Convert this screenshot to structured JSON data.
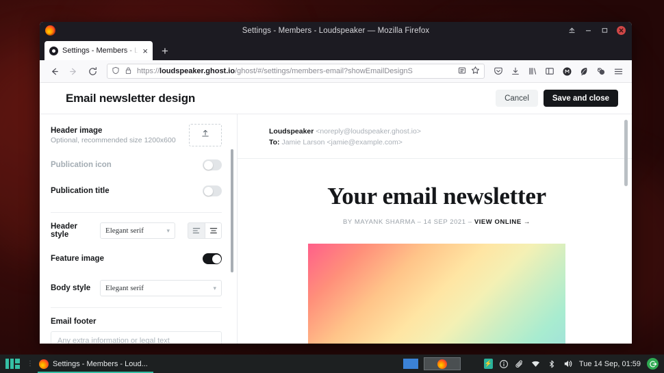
{
  "window": {
    "title": "Settings - Members - Loudspeaker — Mozilla Firefox",
    "controls": {
      "shade_label": "Shade",
      "minimize_label": "Minimize",
      "maximize_label": "Maximize",
      "close_label": "Close"
    }
  },
  "browser": {
    "tab": {
      "title": "Settings - Members - Loud",
      "close_glyph": "×"
    },
    "new_tab_glyph": "+",
    "nav": {
      "back_glyph": "←",
      "forward_glyph": "→",
      "reload_glyph": "↻"
    },
    "url": {
      "scheme": "https://",
      "domain": "loudspeaker.ghost.io",
      "path": "/ghost/#/settings/members-email?showEmailDesignS",
      "full": "https://loudspeaker.ghost.io/ghost/#/settings/members-email?showEmailDesignS"
    },
    "toolbar_icons": [
      "pocket-icon",
      "download-icon",
      "library-icon",
      "sidebar-icon",
      "extension-dark-icon",
      "extension-green-icon",
      "extension-gray-icon",
      "app-menu-icon"
    ]
  },
  "modal": {
    "title": "Email newsletter design",
    "cancel_label": "Cancel",
    "save_label": "Save and close"
  },
  "settings": {
    "header_image": {
      "label": "Header image",
      "sublabel": "Optional, recommended size 1200x600",
      "upload_icon": "upload-icon"
    },
    "publication_icon": {
      "label": "Publication icon",
      "state": "off"
    },
    "publication_title": {
      "label": "Publication title",
      "state": "off"
    },
    "header_style": {
      "label": "Header style",
      "value": "Elegant serif",
      "align_left": "align-left",
      "align_center": "align-center",
      "selected_align": "align-center"
    },
    "feature_image": {
      "label": "Feature image",
      "state": "on"
    },
    "body_style": {
      "label": "Body style",
      "value": "Elegant serif"
    },
    "email_footer": {
      "label": "Email footer",
      "placeholder": "Any extra information or legal text",
      "value": ""
    }
  },
  "preview": {
    "from_name": "Loudspeaker",
    "from_email": "<noreply@loudspeaker.ghost.io>",
    "to_label": "To:",
    "to_value": "Jamie Larson <jamie@example.com>",
    "newsletter_title": "Your email newsletter",
    "byline_author": "BY MAYANK SHARMA",
    "byline_date": "14 SEP 2021",
    "byline_link": "VIEW ONLINE →",
    "byline_sep": "–",
    "hero_colors": [
      "#ff5f8a",
      "#ffc489",
      "#ffe5a3",
      "#a8ecd0",
      "#9fdfdc"
    ]
  },
  "taskbar": {
    "menu_icon": "manjaro-logo-icon",
    "task_title": "Settings - Members - Loud...",
    "clock": "Tue 14 Sep, 01:59",
    "tray_icons": [
      "battery-icon",
      "info-icon",
      "clipboard-icon",
      "wifi-icon",
      "bluetooth-icon",
      "volume-icon"
    ],
    "logout_icon": "logout-icon"
  },
  "colors": {
    "accent_teal": "#35bfa4",
    "ghost_dark": "#15171a",
    "taskbar_bg": "#1d2021",
    "firefox_chrome": "#1c1b22"
  }
}
